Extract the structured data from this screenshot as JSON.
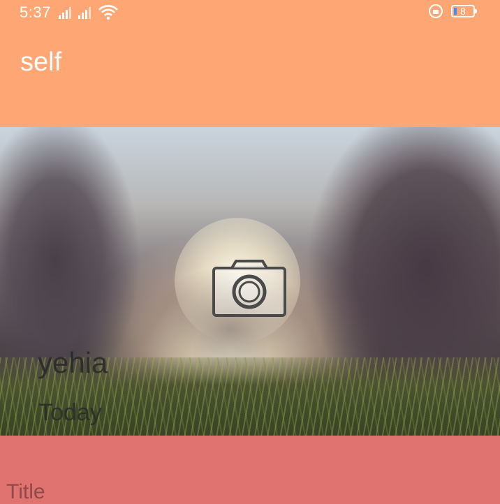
{
  "status_bar": {
    "time": "5:37",
    "battery_level": "8",
    "icons": [
      "signal-icon",
      "signal-icon",
      "wifi-icon",
      "rotation-lock-icon",
      "battery-icon"
    ]
  },
  "app_bar": {
    "title": "self",
    "color": "#ffa675"
  },
  "hero": {
    "icon": "camera-icon",
    "name": "yehia",
    "date": "Today"
  },
  "form": {
    "title_label": "Title",
    "color": "#e07370"
  }
}
